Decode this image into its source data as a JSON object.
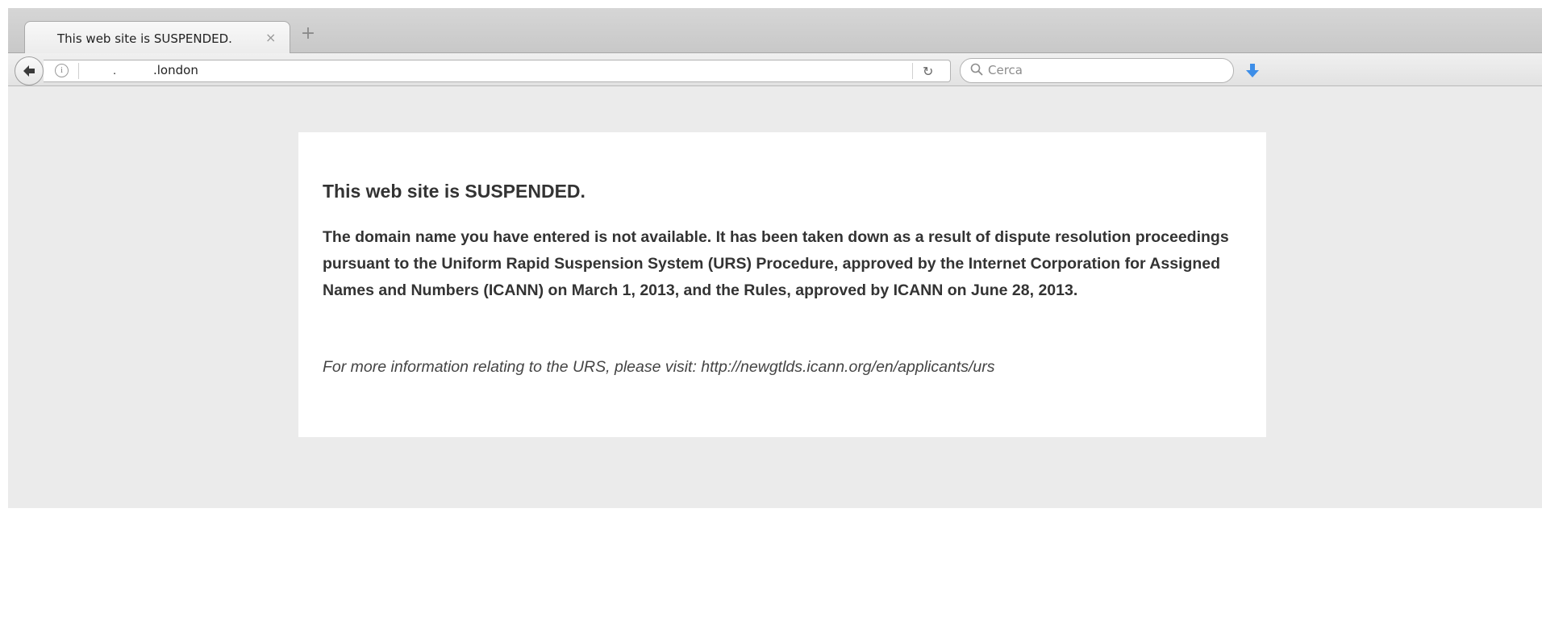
{
  "browser": {
    "tab": {
      "title": "This web site is SUSPENDED.",
      "close_glyph": "×"
    },
    "new_tab_glyph": "+",
    "address": {
      "prefix": ".",
      "url": ".london"
    },
    "search": {
      "placeholder": "Cerca"
    },
    "icons": [
      "back-arrow-icon",
      "info-icon",
      "reload-icon",
      "search-icon",
      "download-icon"
    ]
  },
  "page": {
    "heading": "This web site is SUSPENDED.",
    "body": "The domain name you have entered is not available. It has been taken down as a result of dispute resolution proceedings pursuant to the Uniform Rapid Suspension System (URS) Procedure, approved by the Internet Corporation for Assigned Names and Numbers (ICANN) on March 1, 2013, and the Rules, approved by ICANN on June 28, 2013.",
    "info": "For more information relating to the URS, please visit: http://newgtlds.icann.org/en/applicants/urs"
  },
  "colors": {
    "page_bg": "#ebebeb",
    "card_bg": "#ffffff",
    "text": "#333333",
    "download_accent": "#3d8ee8"
  }
}
